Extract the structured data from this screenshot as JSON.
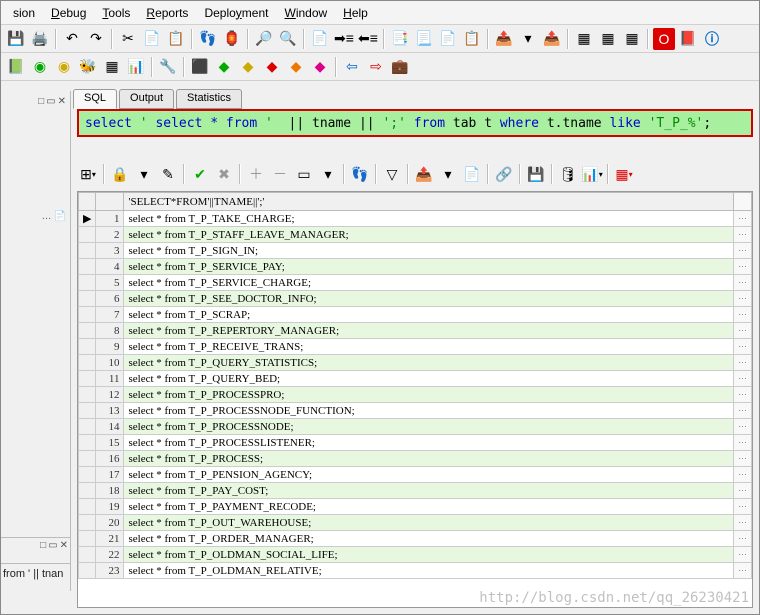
{
  "menu": {
    "items": [
      "sion",
      "Debug",
      "Tools",
      "Reports",
      "Deployment",
      "Window",
      "Help"
    ]
  },
  "tabs": {
    "sql": "SQL",
    "output": "Output",
    "stats": "Statistics"
  },
  "sql": {
    "p1": "select",
    "p2": " ' ",
    "p3": "select * from ",
    "p4": "' || tname || ",
    "p5": "';'",
    "p6": " from ",
    "p7": "tab t ",
    "p8": "where",
    "p9": " t.tname ",
    "p10": "like",
    "p11": " 'T_P_%'",
    "semi": ";"
  },
  "col_header": "'SELECT*FROM'||TNAME||';'",
  "rows": [
    "select * from T_P_TAKE_CHARGE;",
    "select * from T_P_STAFF_LEAVE_MANAGER;",
    "select * from T_P_SIGN_IN;",
    "select * from T_P_SERVICE_PAY;",
    "select * from T_P_SERVICE_CHARGE;",
    "select * from T_P_SEE_DOCTOR_INFO;",
    "select * from T_P_SCRAP;",
    "select * from T_P_REPERTORY_MANAGER;",
    "select * from T_P_RECEIVE_TRANS;",
    "select * from T_P_QUERY_STATISTICS;",
    "select * from T_P_QUERY_BED;",
    "select * from T_P_PROCESSPRO;",
    "select * from T_P_PROCESSNODE_FUNCTION;",
    "select * from T_P_PROCESSNODE;",
    "select * from T_P_PROCESSLISTENER;",
    "select * from T_P_PROCESS;",
    "select * from T_P_PENSION_AGENCY;",
    "select * from T_P_PAY_COST;",
    "select * from T_P_PAYMENT_RECODE;",
    "select * from T_P_OUT_WAREHOUSE;",
    "select * from T_P_ORDER_MANAGER;",
    "select * from T_P_OLDMAN_SOCIAL_LIFE;",
    "select * from T_P_OLDMAN_RELATIVE;"
  ],
  "left_status": " from ' || tnan",
  "watermark": "http://blog.csdn.net/qq_26230421",
  "icons": {
    "save": "💾",
    "print": "🖨️",
    "undo": "↶",
    "redo": "↷",
    "cut": "✂",
    "copy": "📄",
    "paste": "📋",
    "find": "🔍",
    "replace": "Ⓐ",
    "grid": "▦",
    "zoom": "🔎",
    "doc1": "📄",
    "doc2": "📃",
    "indent": "≡",
    "outdent": "≡",
    "doca": "📑",
    "docb": "📑",
    "docc": "📑",
    "docd": "📑",
    "exp": "📤",
    "imp": "📤",
    "tbl": "▦",
    "cfg": "▦",
    "red": "🟥",
    "pdf": "📕",
    "info": "ℹ️",
    "gear": "⚙",
    "run": "▶",
    "stop": "■",
    "check": "✔",
    "plus": "＋",
    "minus": "－",
    "lock": "🔒",
    "edit": "✎",
    "del": "✖",
    "brick": "🧱",
    "arrowl": "◄",
    "arrowr": "►",
    "briefcase": "💼",
    "dd": "▾",
    "pin": "📌",
    "close": "✕",
    "dots": "…",
    "marker": "▶",
    "green": "🟢",
    "yellow": "🟡",
    "org": "🟠"
  }
}
